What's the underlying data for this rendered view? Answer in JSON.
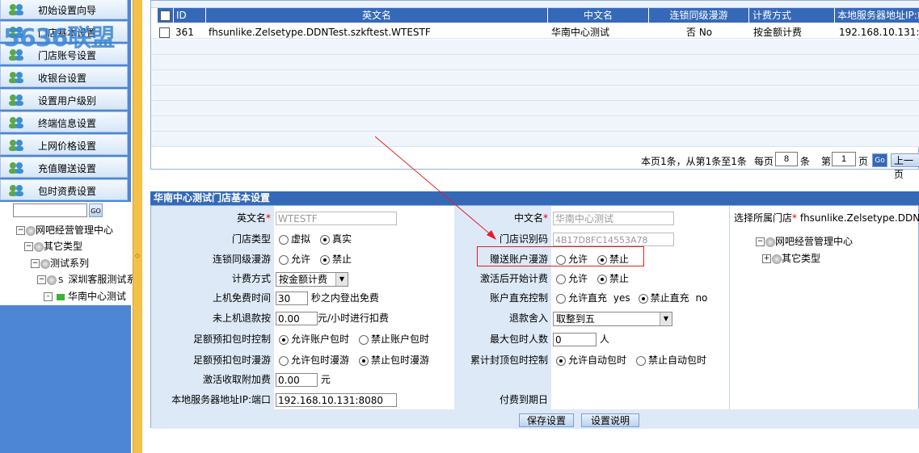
{
  "watermark": "5636联盟",
  "sidebar": {
    "items": [
      {
        "label": "初始设置向导"
      },
      {
        "label": "门店基本设置"
      },
      {
        "label": "门店账号设置"
      },
      {
        "label": "收银台设置"
      },
      {
        "label": "设置用户级别"
      },
      {
        "label": "终端信息设置"
      },
      {
        "label": "上网价格设置"
      },
      {
        "label": "充值赠送设置"
      },
      {
        "label": "包时资费设置"
      }
    ],
    "search_value": "",
    "go_label": "GO",
    "tree": [
      {
        "label": "网吧经营管理中心",
        "toggle": "−"
      },
      {
        "label": "其它类型",
        "toggle": "−"
      },
      {
        "label": "测试系列",
        "toggle": "−"
      },
      {
        "label": "深圳客服测试系",
        "toggle": "−",
        "prefix": "S"
      },
      {
        "label": "华南中心测试",
        "toggle": "-"
      }
    ]
  },
  "grid": {
    "headers": [
      "ID",
      "英文名",
      "中文名",
      "连锁同级漫游",
      "计费方式",
      "本地服务器地址IP:端口"
    ],
    "rows": [
      {
        "id": "361",
        "english": "fhsunlike.Zelsetype.DDNTest.szkftest.WTESTF",
        "chinese": "华南中心测试",
        "roam": "否  No",
        "billing": "按金额计费",
        "server": "192.168.10.131:80"
      }
    ],
    "pager": {
      "summary": "本页1条，从第1条至1条",
      "per_page_label": "每页",
      "per_page": "8",
      "unit": "条",
      "page_prefix": "第",
      "page": "1",
      "page_suffix": "页",
      "go_label": "Go",
      "prev_label": "上一页"
    }
  },
  "form": {
    "title": "华南中心测试门店基本设置",
    "english_name_label": "英文名",
    "english_name": "WTESTF",
    "chinese_name_label": "中文名",
    "chinese_name": "华南中心测试",
    "store_type_label": "门店类型",
    "store_type_opt1": "虚拟",
    "store_type_opt2": "真实",
    "store_code_label": "门店识别码",
    "store_code": "4B17D8FC14553A78",
    "roam_label": "连锁同级漫游",
    "allow": "允许",
    "forbid": "禁止",
    "gift_roam_label": "赠送账户漫游",
    "billing_label": "计费方式",
    "billing_value": "按金额计费",
    "activate_label": "激活后开始计费",
    "free_time_label": "上机免费时间",
    "free_time": "30",
    "free_time_suffix": "秒之内登出免费",
    "direct_charge_label": "账户直充控制",
    "direct_allow": "允许直充",
    "yes": "yes",
    "direct_forbid": "禁止直充",
    "no": "no",
    "refund_label": "未上机退款按",
    "refund_value": "0.00",
    "refund_suffix": "元/小时进行扣费",
    "rounding_label": "退款舍入",
    "rounding_value": "取整到五",
    "prepaid_ctrl_label": "足额预扣包时控制",
    "prepaid_allow": "允许账户包时",
    "prepaid_forbid": "禁止账户包时",
    "max_people_label": "最大包时人数",
    "max_people": "0",
    "max_people_suffix": "人",
    "prepaid_roam_label": "足额预扣包时漫游",
    "prepaid_roam_allow": "允许包时漫游",
    "prepaid_roam_forbid": "禁止包时漫游",
    "cap_ctrl_label": "累计封顶包时控制",
    "cap_allow": "允许自动包时",
    "cap_forbid": "禁止自动包时",
    "surcharge_label": "激活收取附加费",
    "surcharge_value": "0.00",
    "surcharge_suffix": "元",
    "server_label": "本地服务器地址IP:端口",
    "server_value": "192.168.10.131:8080",
    "expire_label": "付费到期日",
    "save_label": "保存设置",
    "help_label": "设置说明",
    "store_select_label": "选择所属门店",
    "store_select_value": "fhsunlike.Zelsetype.DDNTest.",
    "store_tree": [
      {
        "label": "网吧经营管理中心",
        "toggle": "−"
      },
      {
        "label": "其它类型",
        "toggle": "+"
      }
    ]
  },
  "colors": {
    "header": "#3569b8",
    "label_bg": "#dde9f7",
    "splitter": "#f3c14a",
    "annotation": "#e02020"
  }
}
